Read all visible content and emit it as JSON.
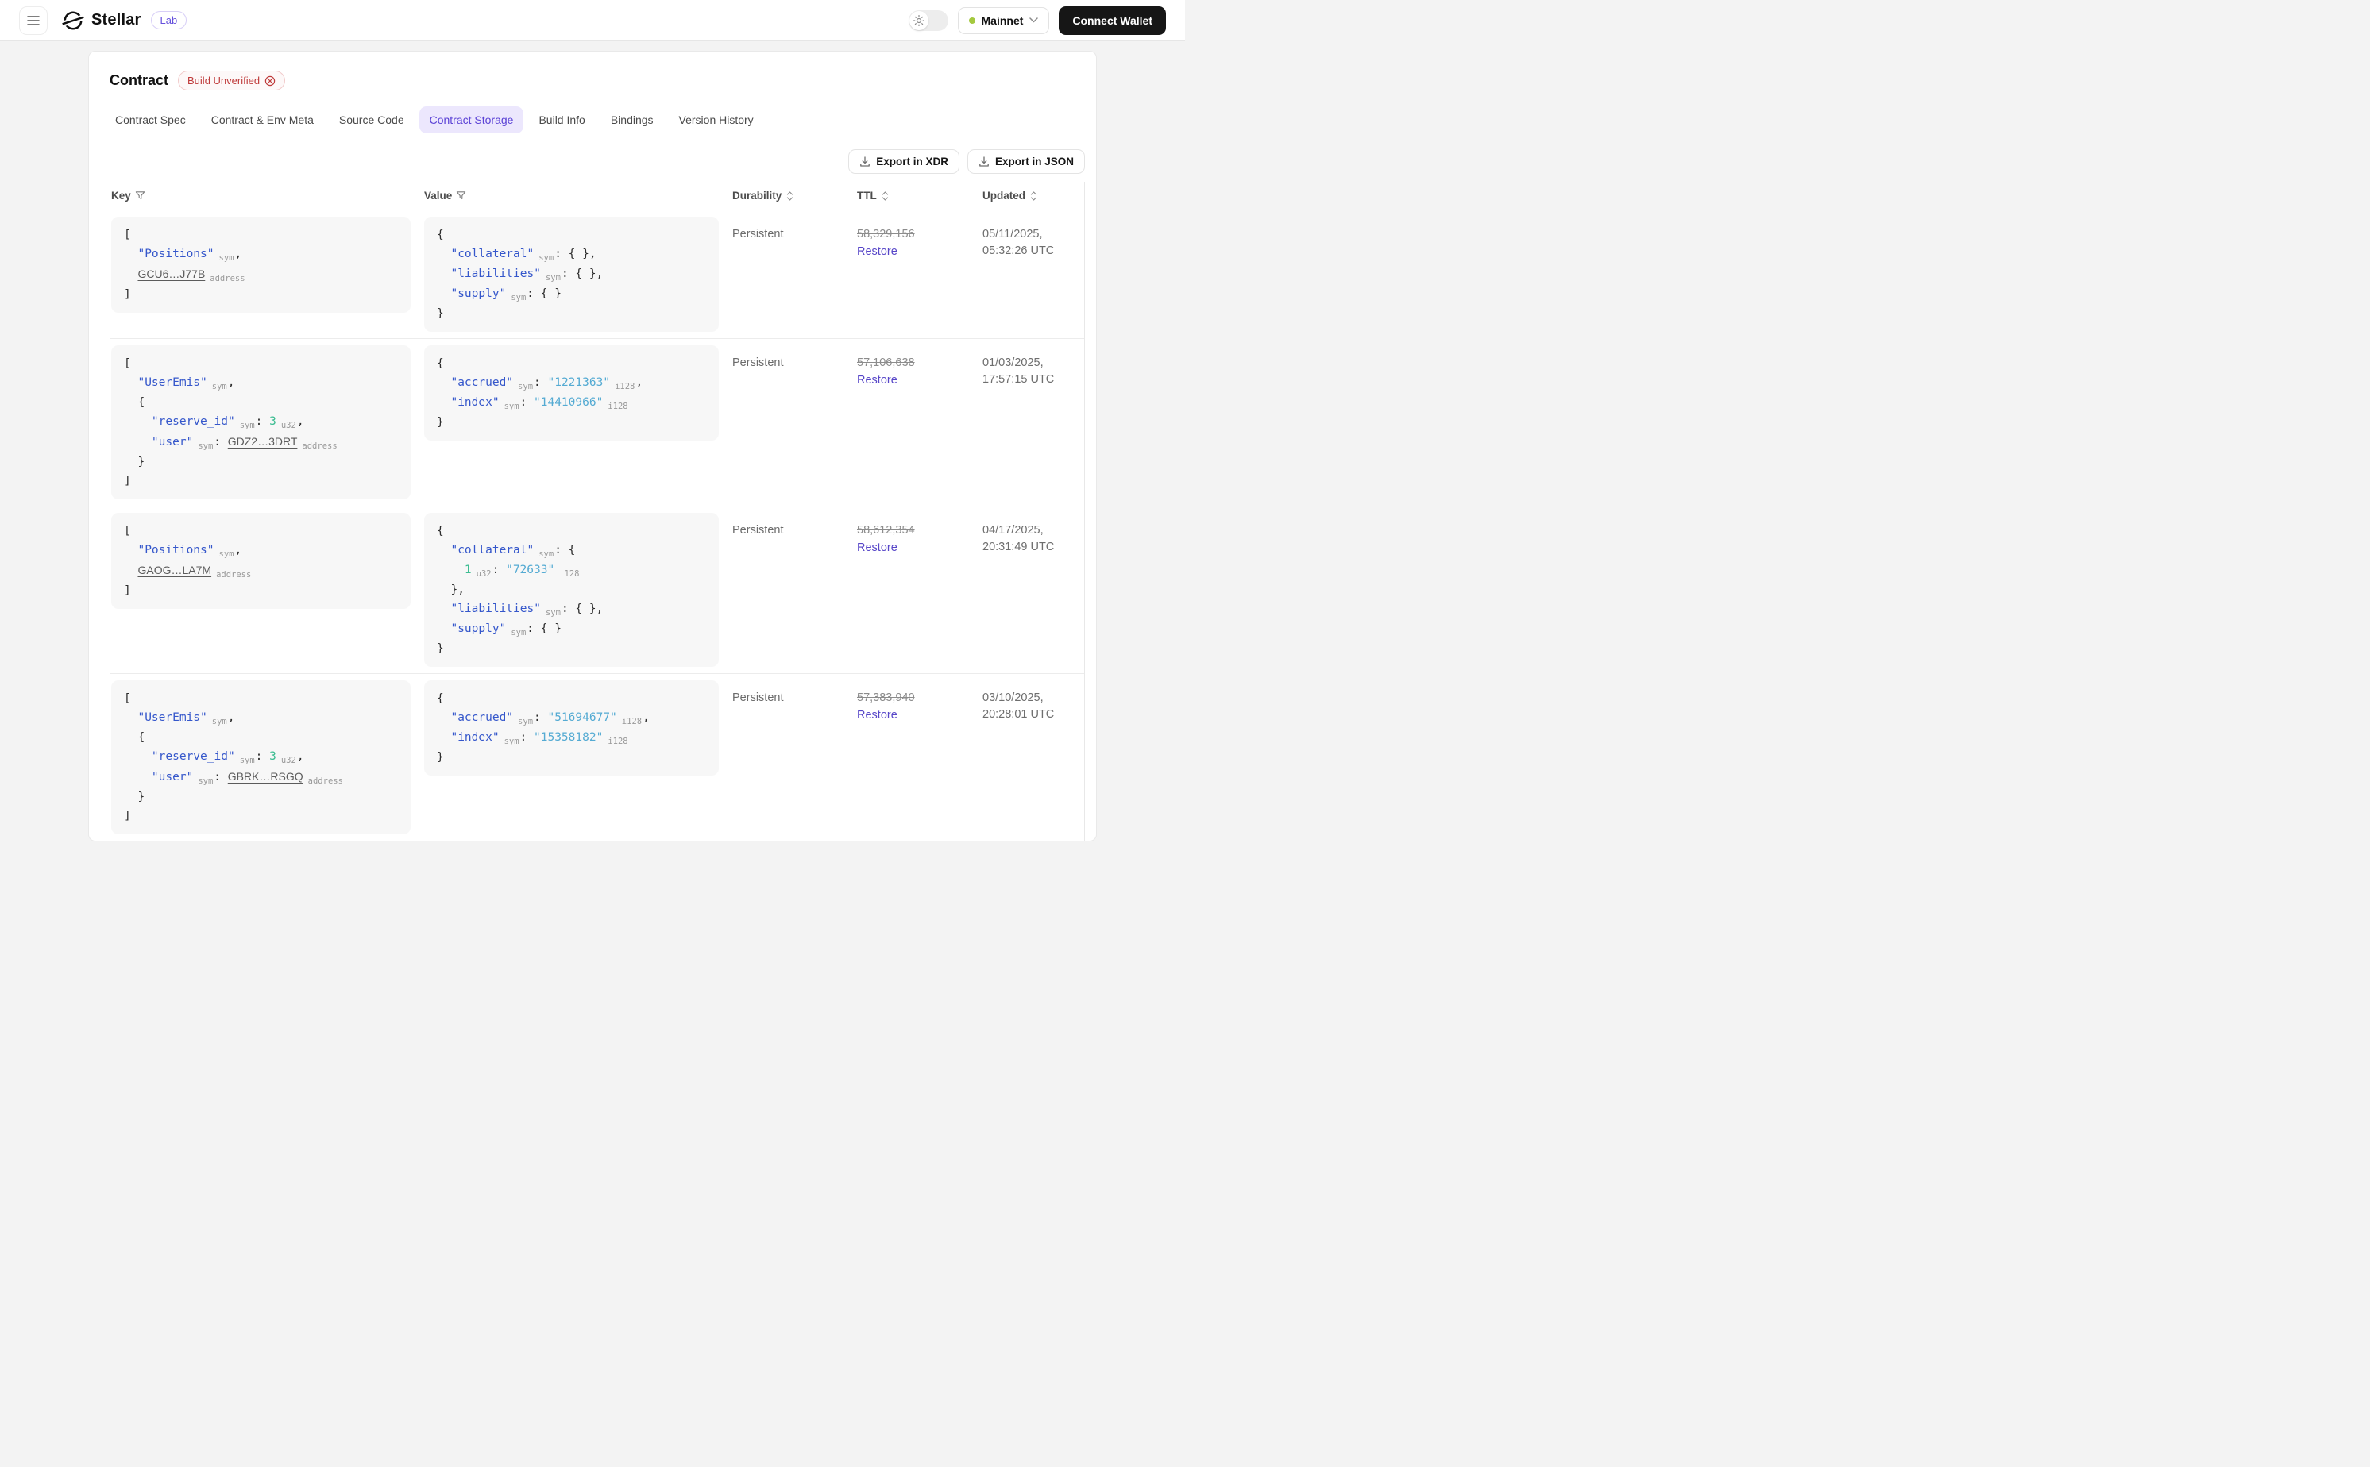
{
  "header": {
    "brand": "Stellar",
    "badge": "Lab",
    "network": {
      "label": "Mainnet",
      "status_color": "#a4c93f"
    },
    "connect_wallet": "Connect Wallet"
  },
  "page": {
    "title": "Contract",
    "build_badge": "Build Unverified",
    "tabs": [
      {
        "label": "Contract Spec",
        "active": false
      },
      {
        "label": "Contract & Env Meta",
        "active": false
      },
      {
        "label": "Source Code",
        "active": false
      },
      {
        "label": "Contract Storage",
        "active": true
      },
      {
        "label": "Build Info",
        "active": false
      },
      {
        "label": "Bindings",
        "active": false
      },
      {
        "label": "Version History",
        "active": false
      }
    ],
    "export_buttons": [
      {
        "label": "Export in XDR"
      },
      {
        "label": "Export in JSON"
      }
    ]
  },
  "colors": {
    "accent_purple": "#5b42d6",
    "tab_active_bg": "#ece7fd",
    "code_key_blue": "#3557cb",
    "code_string_cyan": "#55abd3",
    "code_number_green": "#3dbd92",
    "error_red": "#bf3a3a",
    "restore_purple": "#5746c8"
  },
  "table": {
    "columns": [
      {
        "label": "Key",
        "icon": "filter"
      },
      {
        "label": "Value",
        "icon": "filter"
      },
      {
        "label": "Durability",
        "icon": "sort"
      },
      {
        "label": "TTL",
        "icon": "sort"
      },
      {
        "label": "Updated",
        "icon": "sort"
      }
    ],
    "rows": [
      {
        "key_lines": [
          [
            [
              "p",
              "["
            ]
          ],
          [
            [
              "p",
              "  "
            ],
            [
              "k",
              "\"Positions\""
            ],
            [
              "t",
              "sym"
            ],
            [
              "p",
              ","
            ]
          ],
          [
            [
              "p",
              "  "
            ],
            [
              "a",
              "GCU6…J77B"
            ],
            [
              "t",
              "address"
            ]
          ],
          [
            [
              "p",
              "]"
            ]
          ]
        ],
        "value_lines": [
          [
            [
              "p",
              "{"
            ]
          ],
          [
            [
              "p",
              "  "
            ],
            [
              "k",
              "\"collateral\""
            ],
            [
              "t",
              "sym"
            ],
            [
              "p",
              ": { },"
            ]
          ],
          [
            [
              "p",
              "  "
            ],
            [
              "k",
              "\"liabilities\""
            ],
            [
              "t",
              "sym"
            ],
            [
              "p",
              ": { },"
            ]
          ],
          [
            [
              "p",
              "  "
            ],
            [
              "k",
              "\"supply\""
            ],
            [
              "t",
              "sym"
            ],
            [
              "p",
              ": { }"
            ]
          ],
          [
            [
              "p",
              "}"
            ]
          ]
        ],
        "durability": "Persistent",
        "ttl": "58,329,156",
        "restore_label": "Restore",
        "updated": [
          "05/11/2025,",
          "05:32:26 UTC"
        ]
      },
      {
        "key_lines": [
          [
            [
              "p",
              "["
            ]
          ],
          [
            [
              "p",
              "  "
            ],
            [
              "k",
              "\"UserEmis\""
            ],
            [
              "t",
              "sym"
            ],
            [
              "p",
              ","
            ]
          ],
          [
            [
              "p",
              "  {"
            ]
          ],
          [
            [
              "p",
              "    "
            ],
            [
              "k",
              "\"reserve_id\""
            ],
            [
              "t",
              "sym"
            ],
            [
              "p",
              ": "
            ],
            [
              "n",
              "3"
            ],
            [
              "t",
              "u32"
            ],
            [
              "p",
              ","
            ]
          ],
          [
            [
              "p",
              "    "
            ],
            [
              "k",
              "\"user\""
            ],
            [
              "t",
              "sym"
            ],
            [
              "p",
              ": "
            ],
            [
              "a",
              "GDZ2…3DRT"
            ],
            [
              "t",
              "address"
            ]
          ],
          [
            [
              "p",
              "  }"
            ]
          ],
          [
            [
              "p",
              "]"
            ]
          ]
        ],
        "value_lines": [
          [
            [
              "p",
              "{"
            ]
          ],
          [
            [
              "p",
              "  "
            ],
            [
              "k",
              "\"accrued\""
            ],
            [
              "t",
              "sym"
            ],
            [
              "p",
              ": "
            ],
            [
              "s",
              "\"1221363\""
            ],
            [
              "t",
              "i128"
            ],
            [
              "p",
              ","
            ]
          ],
          [
            [
              "p",
              "  "
            ],
            [
              "k",
              "\"index\""
            ],
            [
              "t",
              "sym"
            ],
            [
              "p",
              ": "
            ],
            [
              "s",
              "\"14410966\""
            ],
            [
              "t",
              "i128"
            ]
          ],
          [
            [
              "p",
              "}"
            ]
          ]
        ],
        "durability": "Persistent",
        "ttl": "57,106,638",
        "restore_label": "Restore",
        "updated": [
          "01/03/2025,",
          "17:57:15 UTC"
        ]
      },
      {
        "key_lines": [
          [
            [
              "p",
              "["
            ]
          ],
          [
            [
              "p",
              "  "
            ],
            [
              "k",
              "\"Positions\""
            ],
            [
              "t",
              "sym"
            ],
            [
              "p",
              ","
            ]
          ],
          [
            [
              "p",
              "  "
            ],
            [
              "a",
              "GAOG…LA7M"
            ],
            [
              "t",
              "address"
            ]
          ],
          [
            [
              "p",
              "]"
            ]
          ]
        ],
        "value_lines": [
          [
            [
              "p",
              "{"
            ]
          ],
          [
            [
              "p",
              "  "
            ],
            [
              "k",
              "\"collateral\""
            ],
            [
              "t",
              "sym"
            ],
            [
              "p",
              ": {"
            ]
          ],
          [
            [
              "p",
              "    "
            ],
            [
              "n",
              "1"
            ],
            [
              "t",
              "u32"
            ],
            [
              "p",
              ": "
            ],
            [
              "s",
              "\"72633\""
            ],
            [
              "t",
              "i128"
            ]
          ],
          [
            [
              "p",
              "  },"
            ]
          ],
          [
            [
              "p",
              "  "
            ],
            [
              "k",
              "\"liabilities\""
            ],
            [
              "t",
              "sym"
            ],
            [
              "p",
              ": { },"
            ]
          ],
          [
            [
              "p",
              "  "
            ],
            [
              "k",
              "\"supply\""
            ],
            [
              "t",
              "sym"
            ],
            [
              "p",
              ": { }"
            ]
          ],
          [
            [
              "p",
              "}"
            ]
          ]
        ],
        "durability": "Persistent",
        "ttl": "58,612,354",
        "restore_label": "Restore",
        "updated": [
          "04/17/2025,",
          "20:31:49 UTC"
        ]
      },
      {
        "key_lines": [
          [
            [
              "p",
              "["
            ]
          ],
          [
            [
              "p",
              "  "
            ],
            [
              "k",
              "\"UserEmis\""
            ],
            [
              "t",
              "sym"
            ],
            [
              "p",
              ","
            ]
          ],
          [
            [
              "p",
              "  {"
            ]
          ],
          [
            [
              "p",
              "    "
            ],
            [
              "k",
              "\"reserve_id\""
            ],
            [
              "t",
              "sym"
            ],
            [
              "p",
              ": "
            ],
            [
              "n",
              "3"
            ],
            [
              "t",
              "u32"
            ],
            [
              "p",
              ","
            ]
          ],
          [
            [
              "p",
              "    "
            ],
            [
              "k",
              "\"user\""
            ],
            [
              "t",
              "sym"
            ],
            [
              "p",
              ": "
            ],
            [
              "a",
              "GBRK…RSGQ"
            ],
            [
              "t",
              "address"
            ]
          ],
          [
            [
              "p",
              "  }"
            ]
          ],
          [
            [
              "p",
              "]"
            ]
          ]
        ],
        "value_lines": [
          [
            [
              "p",
              "{"
            ]
          ],
          [
            [
              "p",
              "  "
            ],
            [
              "k",
              "\"accrued\""
            ],
            [
              "t",
              "sym"
            ],
            [
              "p",
              ": "
            ],
            [
              "s",
              "\"51694677\""
            ],
            [
              "t",
              "i128"
            ],
            [
              "p",
              ","
            ]
          ],
          [
            [
              "p",
              "  "
            ],
            [
              "k",
              "\"index\""
            ],
            [
              "t",
              "sym"
            ],
            [
              "p",
              ": "
            ],
            [
              "s",
              "\"15358182\""
            ],
            [
              "t",
              "i128"
            ]
          ],
          [
            [
              "p",
              "}"
            ]
          ]
        ],
        "durability": "Persistent",
        "ttl": "57,383,940",
        "restore_label": "Restore",
        "updated": [
          "03/10/2025,",
          "20:28:01 UTC"
        ]
      }
    ]
  }
}
